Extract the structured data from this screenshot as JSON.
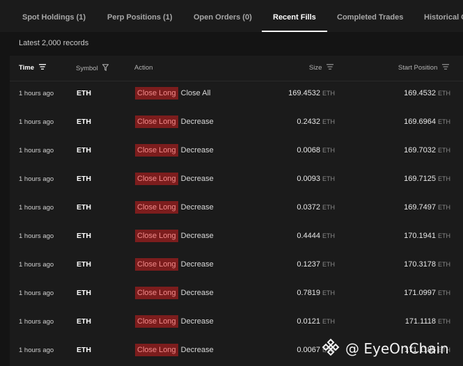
{
  "tabs": [
    {
      "label": "Spot Holdings (1)"
    },
    {
      "label": "Perp Positions (1)"
    },
    {
      "label": "Open Orders (0)"
    },
    {
      "label": "Recent Fills"
    },
    {
      "label": "Completed Trades"
    },
    {
      "label": "Historical O"
    }
  ],
  "active_tab": "Recent Fills",
  "records_label": "Latest 2,000 records",
  "columns": {
    "time": "Time",
    "symbol": "Symbol",
    "action": "Action",
    "size": "Size",
    "start_position": "Start Position"
  },
  "rows": [
    {
      "time": "1 hours ago",
      "symbol": "ETH",
      "side": "Close Long",
      "action": "Close All",
      "size": "169.4532",
      "size_unit": "ETH",
      "start": "169.4532",
      "start_unit": "ETH"
    },
    {
      "time": "1 hours ago",
      "symbol": "ETH",
      "side": "Close Long",
      "action": "Decrease",
      "size": "0.2432",
      "size_unit": "ETH",
      "start": "169.6964",
      "start_unit": "ETH"
    },
    {
      "time": "1 hours ago",
      "symbol": "ETH",
      "side": "Close Long",
      "action": "Decrease",
      "size": "0.0068",
      "size_unit": "ETH",
      "start": "169.7032",
      "start_unit": "ETH"
    },
    {
      "time": "1 hours ago",
      "symbol": "ETH",
      "side": "Close Long",
      "action": "Decrease",
      "size": "0.0093",
      "size_unit": "ETH",
      "start": "169.7125",
      "start_unit": "ETH"
    },
    {
      "time": "1 hours ago",
      "symbol": "ETH",
      "side": "Close Long",
      "action": "Decrease",
      "size": "0.0372",
      "size_unit": "ETH",
      "start": "169.7497",
      "start_unit": "ETH"
    },
    {
      "time": "1 hours ago",
      "symbol": "ETH",
      "side": "Close Long",
      "action": "Decrease",
      "size": "0.4444",
      "size_unit": "ETH",
      "start": "170.1941",
      "start_unit": "ETH"
    },
    {
      "time": "1 hours ago",
      "symbol": "ETH",
      "side": "Close Long",
      "action": "Decrease",
      "size": "0.1237",
      "size_unit": "ETH",
      "start": "170.3178",
      "start_unit": "ETH"
    },
    {
      "time": "1 hours ago",
      "symbol": "ETH",
      "side": "Close Long",
      "action": "Decrease",
      "size": "0.7819",
      "size_unit": "ETH",
      "start": "171.0997",
      "start_unit": "ETH"
    },
    {
      "time": "1 hours ago",
      "symbol": "ETH",
      "side": "Close Long",
      "action": "Decrease",
      "size": "0.0121",
      "size_unit": "ETH",
      "start": "171.1118",
      "start_unit": "ETH"
    },
    {
      "time": "1 hours ago",
      "symbol": "ETH",
      "side": "Close Long",
      "action": "Decrease",
      "size": "0.0067",
      "size_unit": "ETH",
      "start": "171.1185",
      "start_unit": "ETH"
    }
  ],
  "watermark": "@ EyeOnChain",
  "colors": {
    "close_long_bg": "#7c1d1d",
    "close_long_text": "#f18a8a",
    "background": "#141414",
    "panel": "#1b1b1b"
  },
  "icons": {
    "time_sort": "sort-lines-icon",
    "symbol_filter": "filter-funnel-icon",
    "size_sort": "sort-lines-icon",
    "start_sort": "sort-lines-icon",
    "watermark_logo": "binance-diamond-logo"
  }
}
